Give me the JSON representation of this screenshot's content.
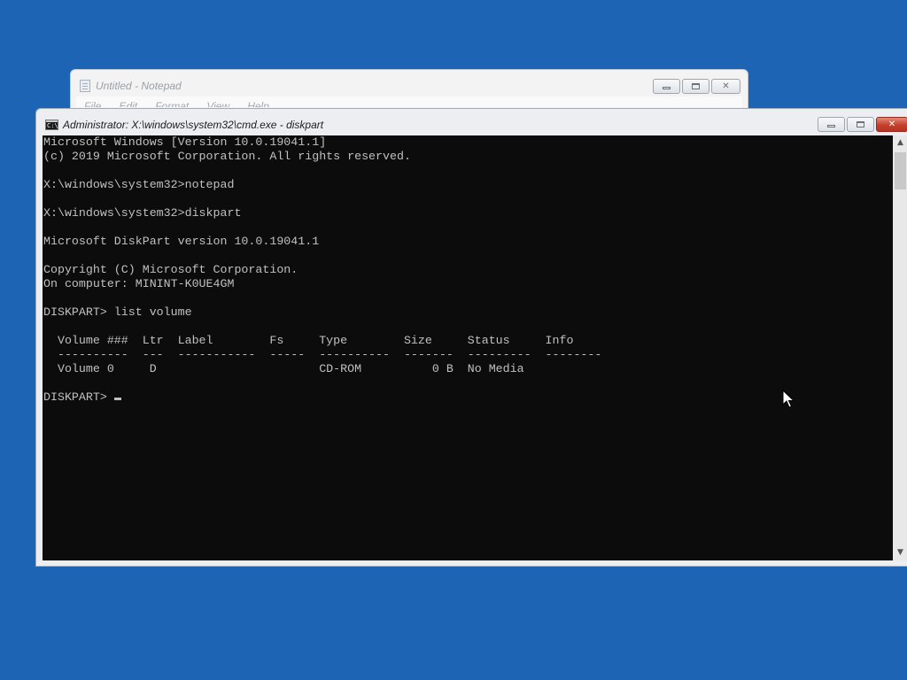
{
  "notepad": {
    "title": "Untitled - Notepad",
    "menu": [
      "File",
      "Edit",
      "Format",
      "View",
      "Help"
    ],
    "icon": "notepad-icon",
    "controls": {
      "minimize": "minimize-icon",
      "maximize": "maximize-icon",
      "close": "✕"
    }
  },
  "cmd": {
    "title": "Administrator: X:\\windows\\system32\\cmd.exe - diskpart",
    "icon": "cmd-icon",
    "icon_text": "C:\\",
    "controls": {
      "minimize": "minimize-icon",
      "maximize": "maximize-icon",
      "close": "✕"
    },
    "lines": [
      "Microsoft Windows [Version 10.0.19041.1]",
      "(c) 2019 Microsoft Corporation. All rights reserved.",
      "",
      "X:\\windows\\system32>notepad",
      "",
      "X:\\windows\\system32>diskpart",
      "",
      "Microsoft DiskPart version 10.0.19041.1",
      "",
      "Copyright (C) Microsoft Corporation.",
      "On computer: MININT-K0UE4GM",
      "",
      "DISKPART> list volume",
      "",
      "  Volume ###  Ltr  Label        Fs     Type        Size     Status     Info",
      "  ----------  ---  -----------  -----  ----------  -------  ---------  --------",
      "  Volume 0     D                       CD-ROM          0 B  No Media",
      ""
    ],
    "prompt": "DISKPART> "
  },
  "colors": {
    "desktop": "#1e64b4",
    "console_bg": "#0c0c0c",
    "console_text": "#c0c0c0",
    "close_button": "#c5402c"
  }
}
